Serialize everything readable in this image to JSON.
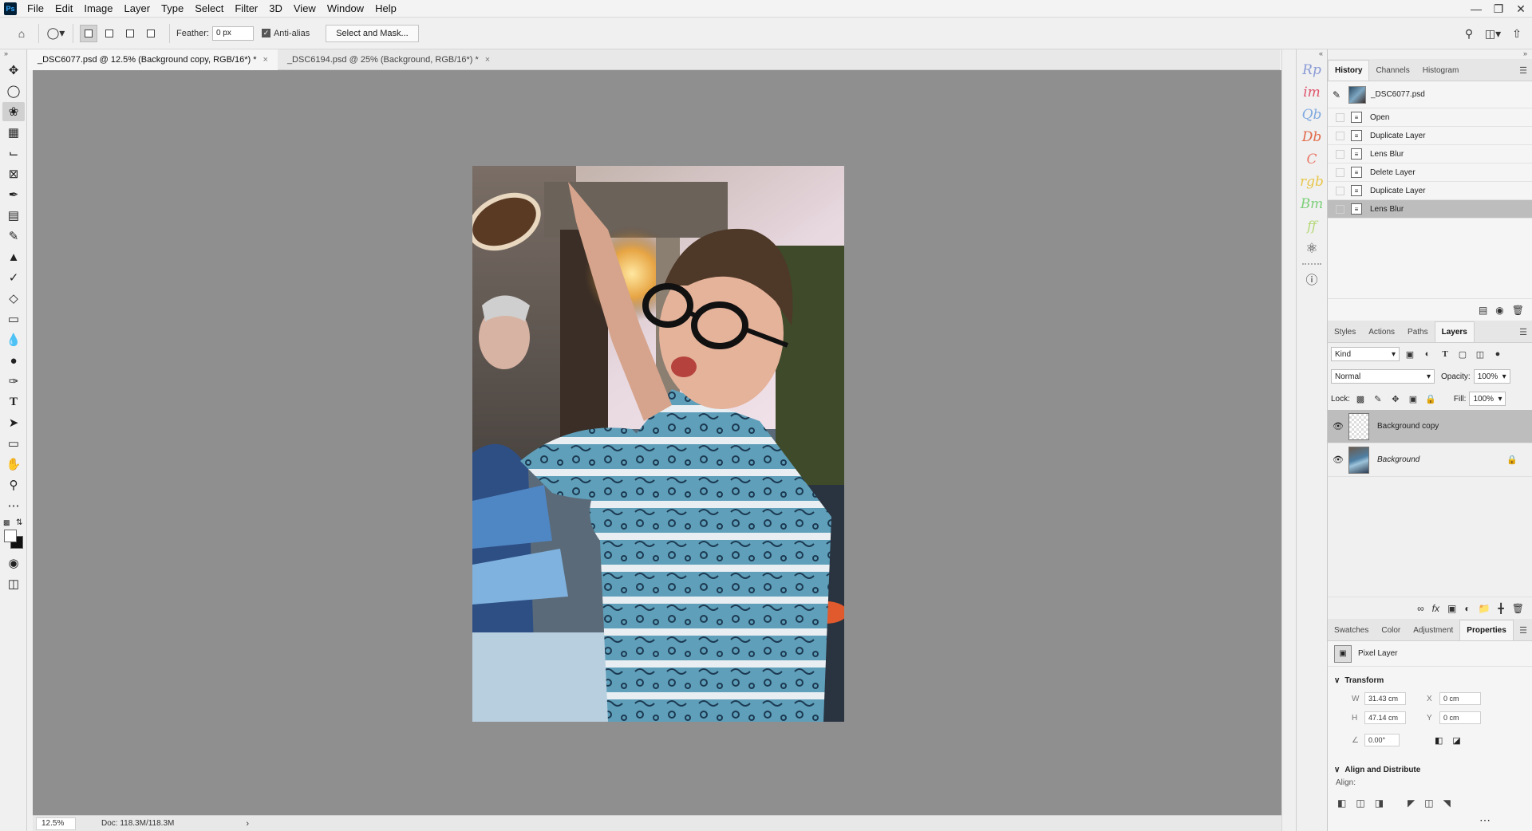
{
  "menu": {
    "app_logo": "Ps",
    "items": [
      "File",
      "Edit",
      "Image",
      "Layer",
      "Type",
      "Select",
      "Filter",
      "3D",
      "View",
      "Window",
      "Help"
    ],
    "window_controls": [
      "minimize-icon",
      "restore-icon",
      "close-icon"
    ]
  },
  "options": {
    "feather_label": "Feather:",
    "feather_value": "0 px",
    "antialias_label": "Anti-alias",
    "antialias_checked": true,
    "select_mask_label": "Select and Mask..."
  },
  "tabs": [
    {
      "label": "_DSC6077.psd @ 12.5% (Background copy, RGB/16*) *",
      "active": true
    },
    {
      "label": "_DSC6194.psd @ 25% (Background, RGB/16*) *",
      "active": false
    }
  ],
  "status": {
    "zoom": "12.5%",
    "doc_size": "Doc: 118.3M/118.3M"
  },
  "plugins": [
    {
      "label": "Rp",
      "color": "#8a9bd6"
    },
    {
      "label": "im",
      "color": "#e0536b"
    },
    {
      "label": "Qb",
      "color": "#7ea9e0"
    },
    {
      "label": "Db",
      "color": "#e06a4a"
    },
    {
      "label": "C",
      "color": "#e97a6a"
    },
    {
      "label": "rgb",
      "color": "#e8c64a"
    },
    {
      "label": "Bm",
      "color": "#7ccf7a"
    },
    {
      "label": "ff",
      "color": "#b6d97a"
    }
  ],
  "history": {
    "tabs": [
      "History",
      "Channels",
      "Histogram"
    ],
    "active_tab": "History",
    "snapshot": "_DSC6077.psd",
    "steps": [
      "Open",
      "Duplicate Layer",
      "Lens Blur",
      "Delete Layer",
      "Duplicate Layer",
      "Lens Blur"
    ],
    "active_step": 5
  },
  "layers_panel": {
    "tabs": [
      "Styles",
      "Actions",
      "Paths",
      "Layers"
    ],
    "active_tab": "Layers",
    "filter_kind": "Kind",
    "blend_mode": "Normal",
    "opacity_label": "Opacity:",
    "opacity": "100%",
    "lock_label": "Lock:",
    "fill_label": "Fill:",
    "fill": "100%",
    "layers": [
      {
        "name": "Background copy",
        "active": true,
        "locked": false
      },
      {
        "name": "Background",
        "active": false,
        "locked": true
      }
    ]
  },
  "properties": {
    "tabs": [
      "Swatches",
      "Color",
      "Adjustment",
      "Properties"
    ],
    "active_tab": "Properties",
    "layer_type": "Pixel Layer",
    "transform_label": "Transform",
    "w_label": "W",
    "w": "31.43 cm",
    "h_label": "H",
    "h": "47.14 cm",
    "x_label": "X",
    "x": "0 cm",
    "y_label": "Y",
    "y": "0 cm",
    "angle": "0.00°",
    "align_label": "Align and Distribute",
    "align_sub": "Align:"
  }
}
